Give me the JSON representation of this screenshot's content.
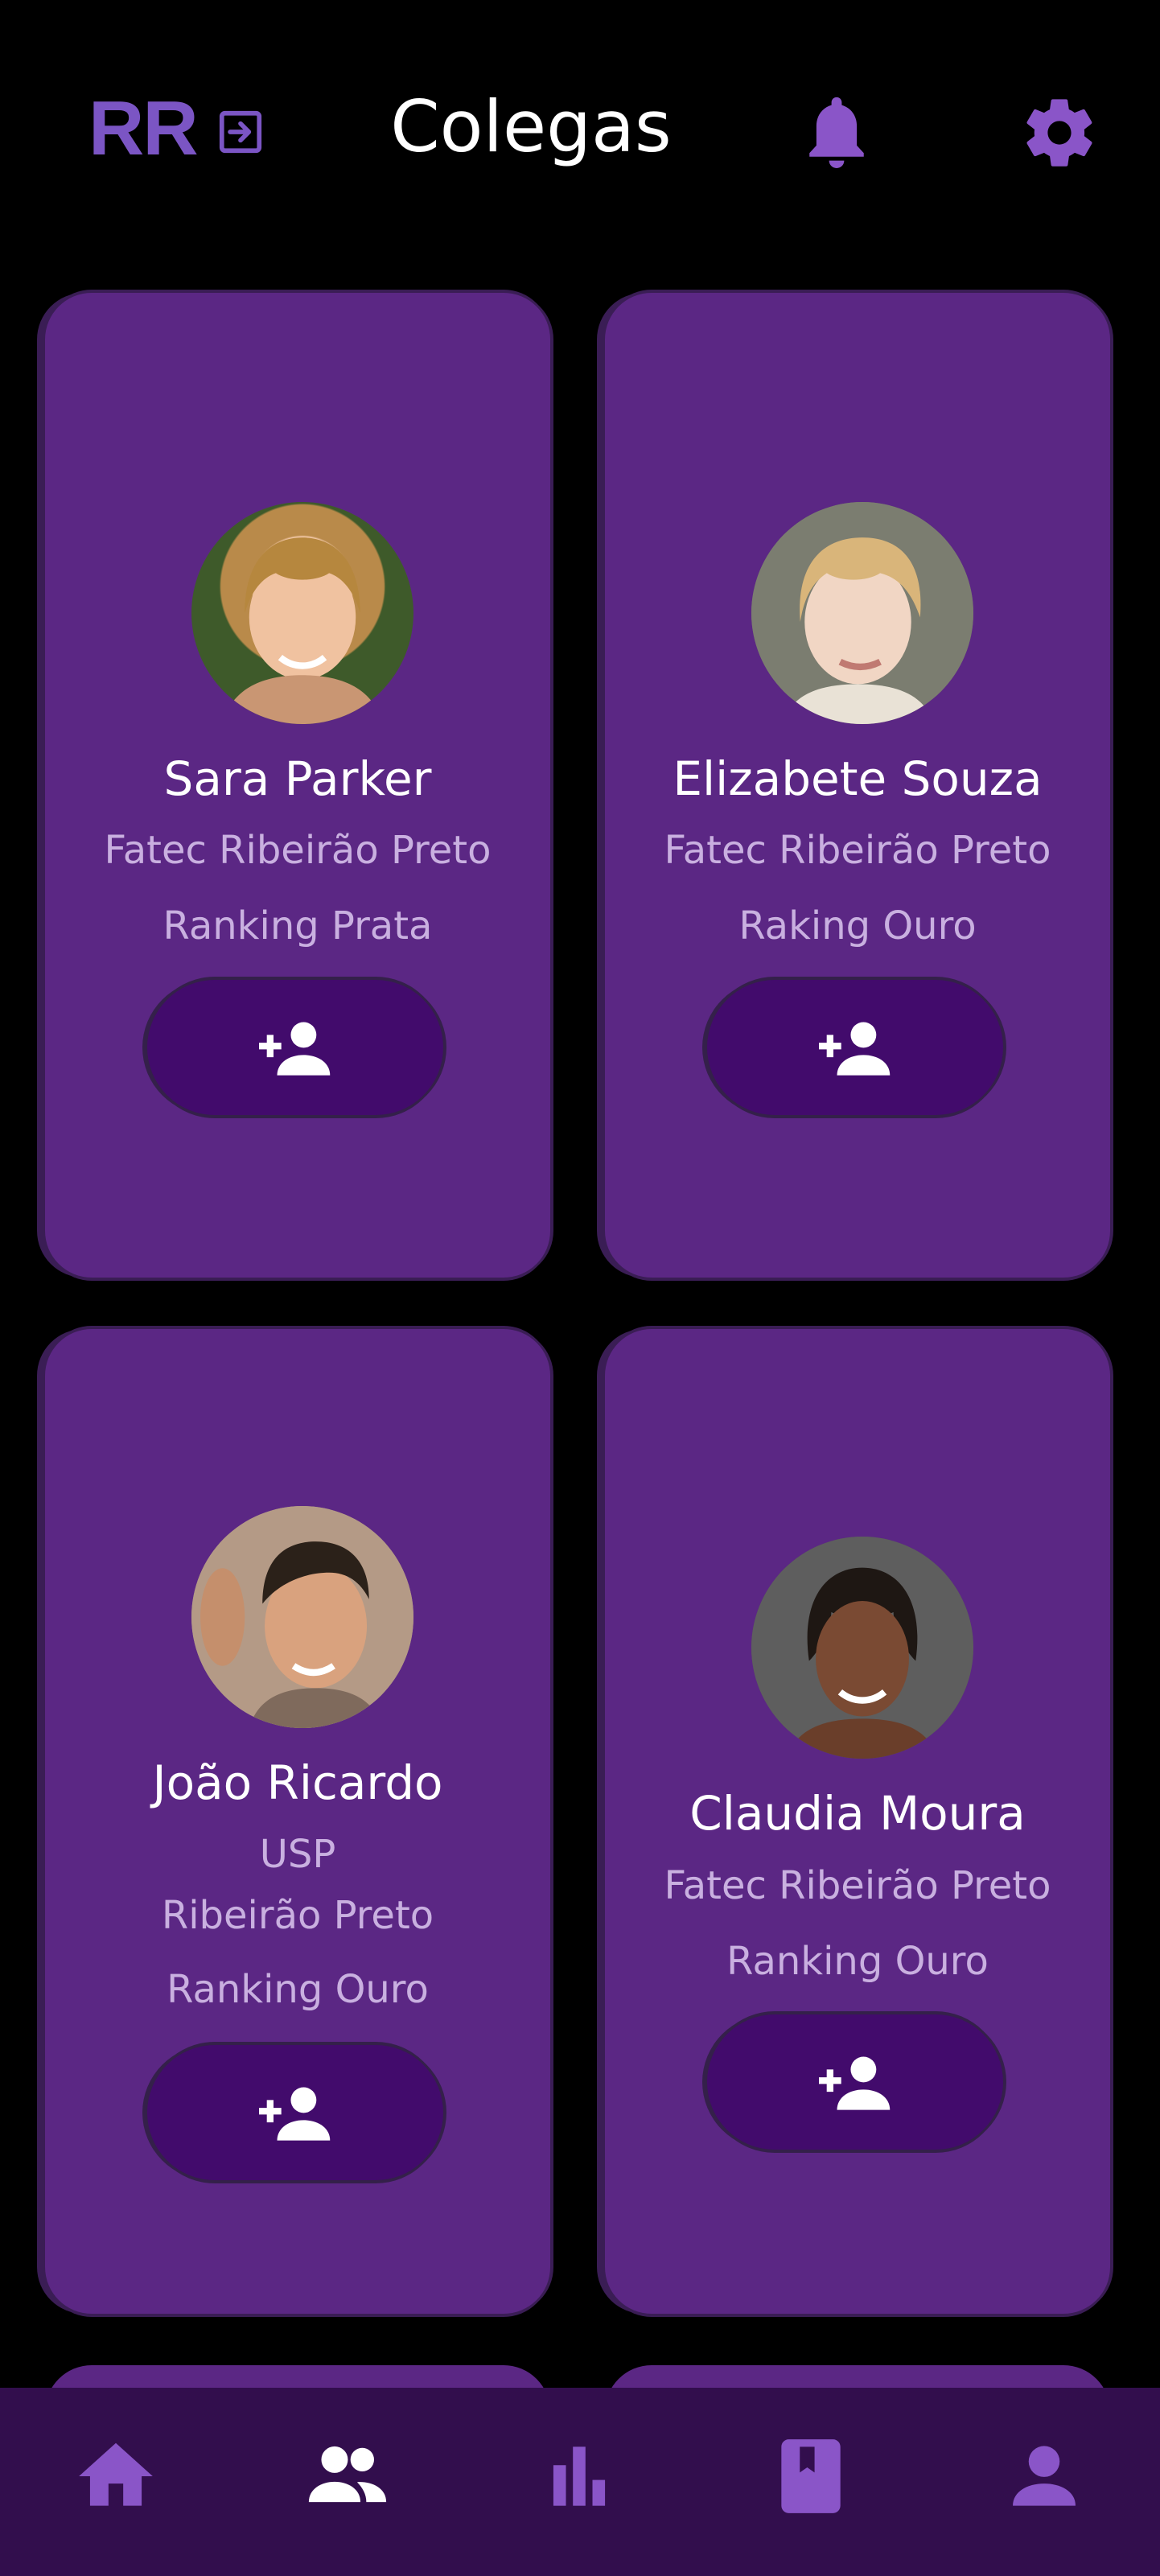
{
  "header": {
    "logo": "RR",
    "title": "Colegas",
    "icons": [
      "login-icon",
      "bell-icon",
      "gear-icon"
    ]
  },
  "colleagues": [
    {
      "name": "Sara Parker",
      "institution": "Fatec Ribeirão Preto",
      "ranking": "Ranking Prata",
      "add_icon": "person-add-icon"
    },
    {
      "name": "Elizabete Souza",
      "institution": "Fatec Ribeirão Preto",
      "ranking": "Raking Ouro",
      "add_icon": "person-add-icon"
    },
    {
      "name": "João Ricardo",
      "institution_line1": "USP",
      "institution_line2": "Ribeirão Preto",
      "ranking": "Ranking Ouro",
      "add_icon": "person-add-icon"
    },
    {
      "name": "Claudia Moura",
      "institution": "Fatec Ribeirão Preto",
      "ranking": "Ranking Ouro",
      "add_icon": "person-add-icon"
    }
  ],
  "bottom_nav": {
    "items": [
      "home-icon",
      "group-icon",
      "bar-chart-icon",
      "bookmark-book-icon",
      "person-icon"
    ],
    "active": "group-icon"
  },
  "colors": {
    "background": "#000000",
    "card": "#5b2784",
    "button": "#420b6c",
    "accent": "#8a55c8",
    "nav": "#320e4d",
    "secondary_text": "#c9b0e0"
  }
}
